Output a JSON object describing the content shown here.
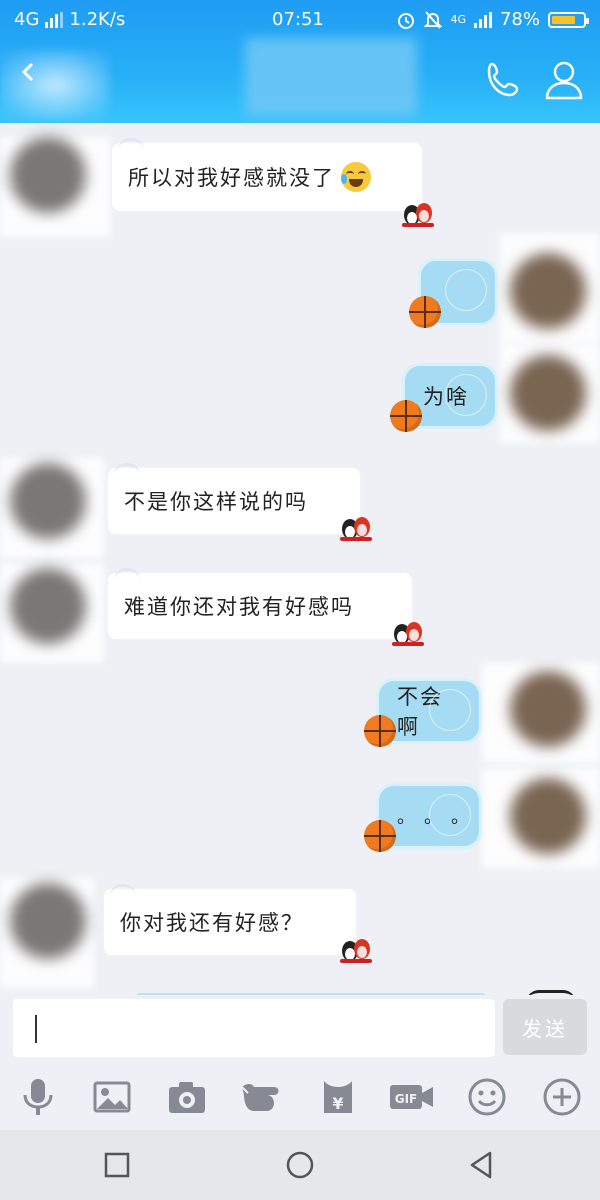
{
  "status_bar": {
    "network": "4G",
    "speed": "1.2K/s",
    "time": "07:51",
    "net_small": "4G",
    "battery": "78%",
    "battery_level": 0.78
  },
  "header": {
    "icons": [
      "back-icon",
      "phone-icon",
      "profile-icon"
    ]
  },
  "messages": [
    {
      "side": "in",
      "text": "所以对我好感就没了"
    },
    {
      "side": "out",
      "text": ""
    },
    {
      "side": "out",
      "text": "为啥"
    },
    {
      "side": "in",
      "text": "不是你这样说的吗"
    },
    {
      "side": "in",
      "text": "难道你还对我有好感吗"
    },
    {
      "side": "out",
      "text": "不会啊"
    },
    {
      "side": "out",
      "text": "。。。"
    },
    {
      "side": "in",
      "text": "你对我还有好感？"
    }
  ],
  "input": {
    "value": "",
    "send_label": "发送"
  },
  "toolbar": {
    "icons": [
      "microphone-icon",
      "image-icon",
      "camera-icon",
      "poke-icon",
      "red-packet-icon",
      "gif-icon",
      "emoji-icon",
      "plus-icon"
    ],
    "gif_label": "GIF",
    "yuan_label": "¥"
  },
  "nav": {
    "icons": [
      "recent-apps-icon",
      "home-icon",
      "back-nav-icon"
    ]
  },
  "colors": {
    "header": "#27aff7",
    "outgoing_bubble": "#a6dcf3",
    "battery": "#f6c12a",
    "send_disabled": "#d8dade"
  }
}
